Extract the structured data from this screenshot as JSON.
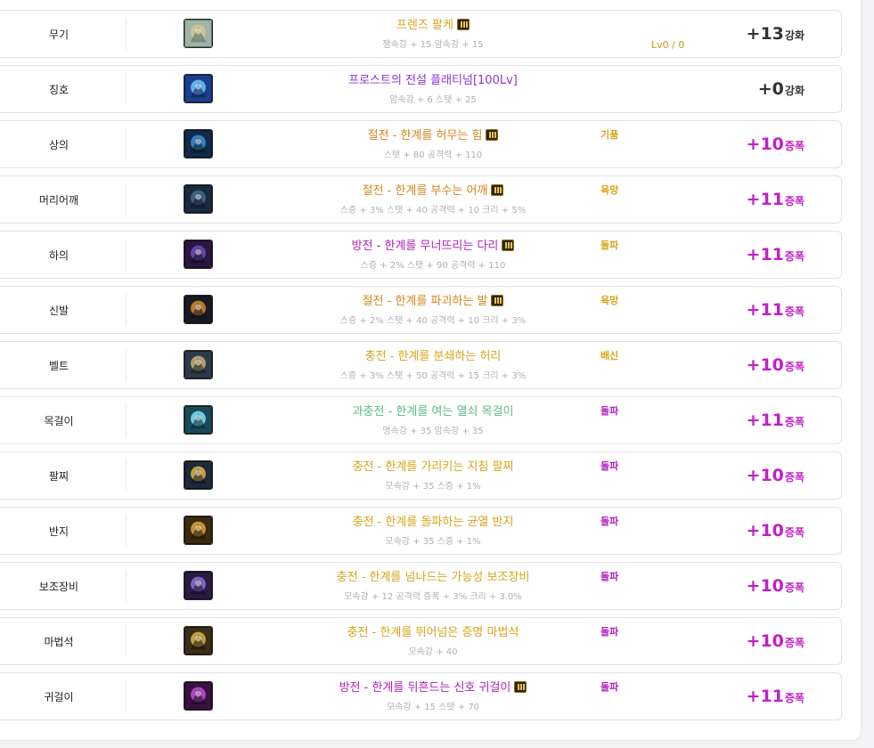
{
  "colors": {
    "gold": "#d8a41a",
    "purple": "#8b34d2",
    "magenta": "#b021bd",
    "green": "#5ab88c",
    "orange": "#d3861c",
    "enh_dark": "#333333",
    "enh_mag": "#c21fc6"
  },
  "equipment": [
    {
      "slot": "무기",
      "icon": "weapon-icon",
      "name": "프렌즈 팔케",
      "name_color": "#d8a41a",
      "badge": true,
      "stats": "잼속강 + 15 암속강 + 15",
      "extra": "",
      "extra_color": "",
      "level": "Lv0 / 0",
      "enh_value": "+13",
      "enh_unit": "강화",
      "enh_color": "#333333"
    },
    {
      "slot": "칭호",
      "icon": "title-icon",
      "name": "프로스트의 전설 플래티넘[100Lv]",
      "name_color": "#8b34d2",
      "badge": false,
      "stats": "암속강 + 6 스탯 + 25",
      "extra": "",
      "extra_color": "",
      "level": "",
      "enh_value": "+0",
      "enh_unit": "강화",
      "enh_color": "#333333"
    },
    {
      "slot": "상의",
      "icon": "top-armor-icon",
      "name": "절전 - 한계를 허무는 힘",
      "name_color": "#d3861c",
      "badge": true,
      "stats": "스탯 + 80 공격력 + 110",
      "extra": "기품",
      "extra_color": "#d8a41a",
      "level": "",
      "enh_value": "+10",
      "enh_unit": "증폭",
      "enh_color": "#c21fc6"
    },
    {
      "slot": "머리어깨",
      "icon": "shoulder-icon",
      "name": "절전 - 한계를 부수는 어깨",
      "name_color": "#d3861c",
      "badge": true,
      "stats": "스증 + 3% 스탯 + 40 공격력 + 10 크리 + 5%",
      "extra": "욕망",
      "extra_color": "#d8a41a",
      "level": "",
      "enh_value": "+11",
      "enh_unit": "증폭",
      "enh_color": "#c21fc6"
    },
    {
      "slot": "하의",
      "icon": "bottom-armor-icon",
      "name": "방전 - 한계를 무너뜨리는 다리",
      "name_color": "#b021bd",
      "badge": true,
      "stats": "스증 + 2% 스탯 + 90 공격력 + 110",
      "extra": "돌파",
      "extra_color": "#d8a41a",
      "level": "",
      "enh_value": "+11",
      "enh_unit": "증폭",
      "enh_color": "#c21fc6"
    },
    {
      "slot": "신발",
      "icon": "shoes-icon",
      "name": "절전 - 한계를 파괴하는 발",
      "name_color": "#d3861c",
      "badge": true,
      "stats": "스증 + 2% 스탯 + 40 공격력 + 10 크리 + 3%",
      "extra": "욕망",
      "extra_color": "#d8a41a",
      "level": "",
      "enh_value": "+11",
      "enh_unit": "증폭",
      "enh_color": "#c21fc6"
    },
    {
      "slot": "벨트",
      "icon": "belt-icon",
      "name": "충전 - 한계를 분쇄하는 허리",
      "name_color": "#d8a41a",
      "badge": false,
      "stats": "스증 + 3% 스탯 + 50 공격력 + 15 크리 + 3%",
      "extra": "배신",
      "extra_color": "#d8a41a",
      "level": "",
      "enh_value": "+10",
      "enh_unit": "증폭",
      "enh_color": "#c21fc6"
    },
    {
      "slot": "목걸이",
      "icon": "necklace-icon",
      "name": "과충전 - 한계를 여는 열쇠 목걸이",
      "name_color": "#5ab88c",
      "badge": false,
      "stats": "명속강 + 35 암속강 + 35",
      "extra": "돌파",
      "extra_color": "#b021bd",
      "level": "",
      "enh_value": "+11",
      "enh_unit": "증폭",
      "enh_color": "#c21fc6"
    },
    {
      "slot": "팔찌",
      "icon": "bracelet-icon",
      "name": "충전 - 한계를 가리키는 지침 팔찌",
      "name_color": "#d8a41a",
      "badge": false,
      "stats": "모속강 + 35 스증 + 1%",
      "extra": "돌파",
      "extra_color": "#b021bd",
      "level": "",
      "enh_value": "+10",
      "enh_unit": "증폭",
      "enh_color": "#c21fc6"
    },
    {
      "slot": "반지",
      "icon": "ring-icon",
      "name": "충전 - 한계를 돌파하는 균열 반지",
      "name_color": "#d8a41a",
      "badge": false,
      "stats": "모속강 + 35 스증 + 1%",
      "extra": "돌파",
      "extra_color": "#b021bd",
      "level": "",
      "enh_value": "+10",
      "enh_unit": "증폭",
      "enh_color": "#c21fc6"
    },
    {
      "slot": "보조장비",
      "icon": "sub-equipment-icon",
      "name": "충전 - 한계를 넘나드는 가능성 보조장비",
      "name_color": "#d8a41a",
      "badge": false,
      "stats": "모속강 + 12 공격력 증폭 + 3% 크리 + 3.0%",
      "extra": "돌파",
      "extra_color": "#b021bd",
      "level": "",
      "enh_value": "+10",
      "enh_unit": "증폭",
      "enh_color": "#c21fc6"
    },
    {
      "slot": "마법석",
      "icon": "magic-stone-icon",
      "name": "충전 - 한계를 뛰어넘은 증명 마법석",
      "name_color": "#d8a41a",
      "badge": false,
      "stats": "모속강 + 40",
      "extra": "돌파",
      "extra_color": "#b021bd",
      "level": "",
      "enh_value": "+10",
      "enh_unit": "증폭",
      "enh_color": "#c21fc6"
    },
    {
      "slot": "귀걸이",
      "icon": "earring-icon",
      "name": "방전 - 한계를 뒤흔드는 신호 귀걸이",
      "name_color": "#b021bd",
      "badge": true,
      "stats": "모속강 + 15 스탯 + 70",
      "extra": "돌파",
      "extra_color": "#b021bd",
      "level": "",
      "enh_value": "+11",
      "enh_unit": "증폭",
      "enh_color": "#c21fc6"
    }
  ]
}
